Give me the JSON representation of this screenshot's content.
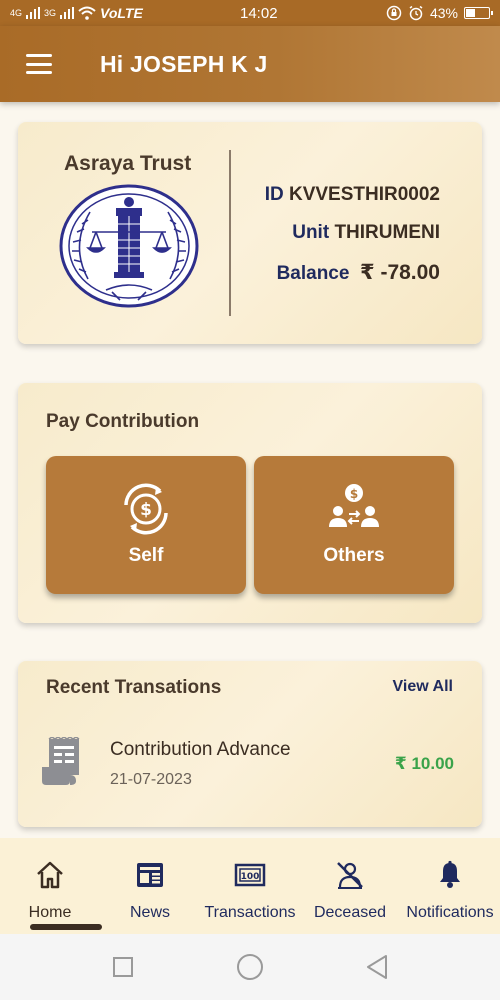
{
  "status_bar": {
    "signal1": "4G",
    "signal2": "3G",
    "network": "VoLTE",
    "time": "14:02",
    "battery": "43%",
    "battery_level": 0.43
  },
  "app_bar": {
    "title": "Hi JOSEPH K J"
  },
  "trust_card": {
    "name": "Asraya Trust",
    "id_label": "ID",
    "id_value": "KVVESTHIR0002",
    "unit_label": "Unit",
    "unit_value": "THIRUMENI",
    "balance_label": "Balance",
    "balance_value": "₹ -78.00"
  },
  "pay_card": {
    "heading": "Pay Contribution",
    "self_label": "Self",
    "others_label": "Others"
  },
  "recent_card": {
    "heading": "Recent Transations",
    "view_all": "View All",
    "transactions": [
      {
        "title": "Contribution Advance",
        "date": "21-07-2023",
        "amount": "₹ 10.00"
      }
    ]
  },
  "bottom_nav": {
    "items": [
      {
        "label": "Home",
        "icon": "home-icon"
      },
      {
        "label": "News",
        "icon": "newspaper-icon"
      },
      {
        "label": "Transactions",
        "icon": "money-icon"
      },
      {
        "label": "Deceased",
        "icon": "deceased-icon"
      },
      {
        "label": "Notifications",
        "icon": "bell-icon"
      }
    ],
    "active": "Home"
  },
  "colors": {
    "accent": "#b67a3a",
    "app_bar": "#a96b27",
    "navy": "#1f2a5e",
    "amount_green": "#3aa34a"
  }
}
